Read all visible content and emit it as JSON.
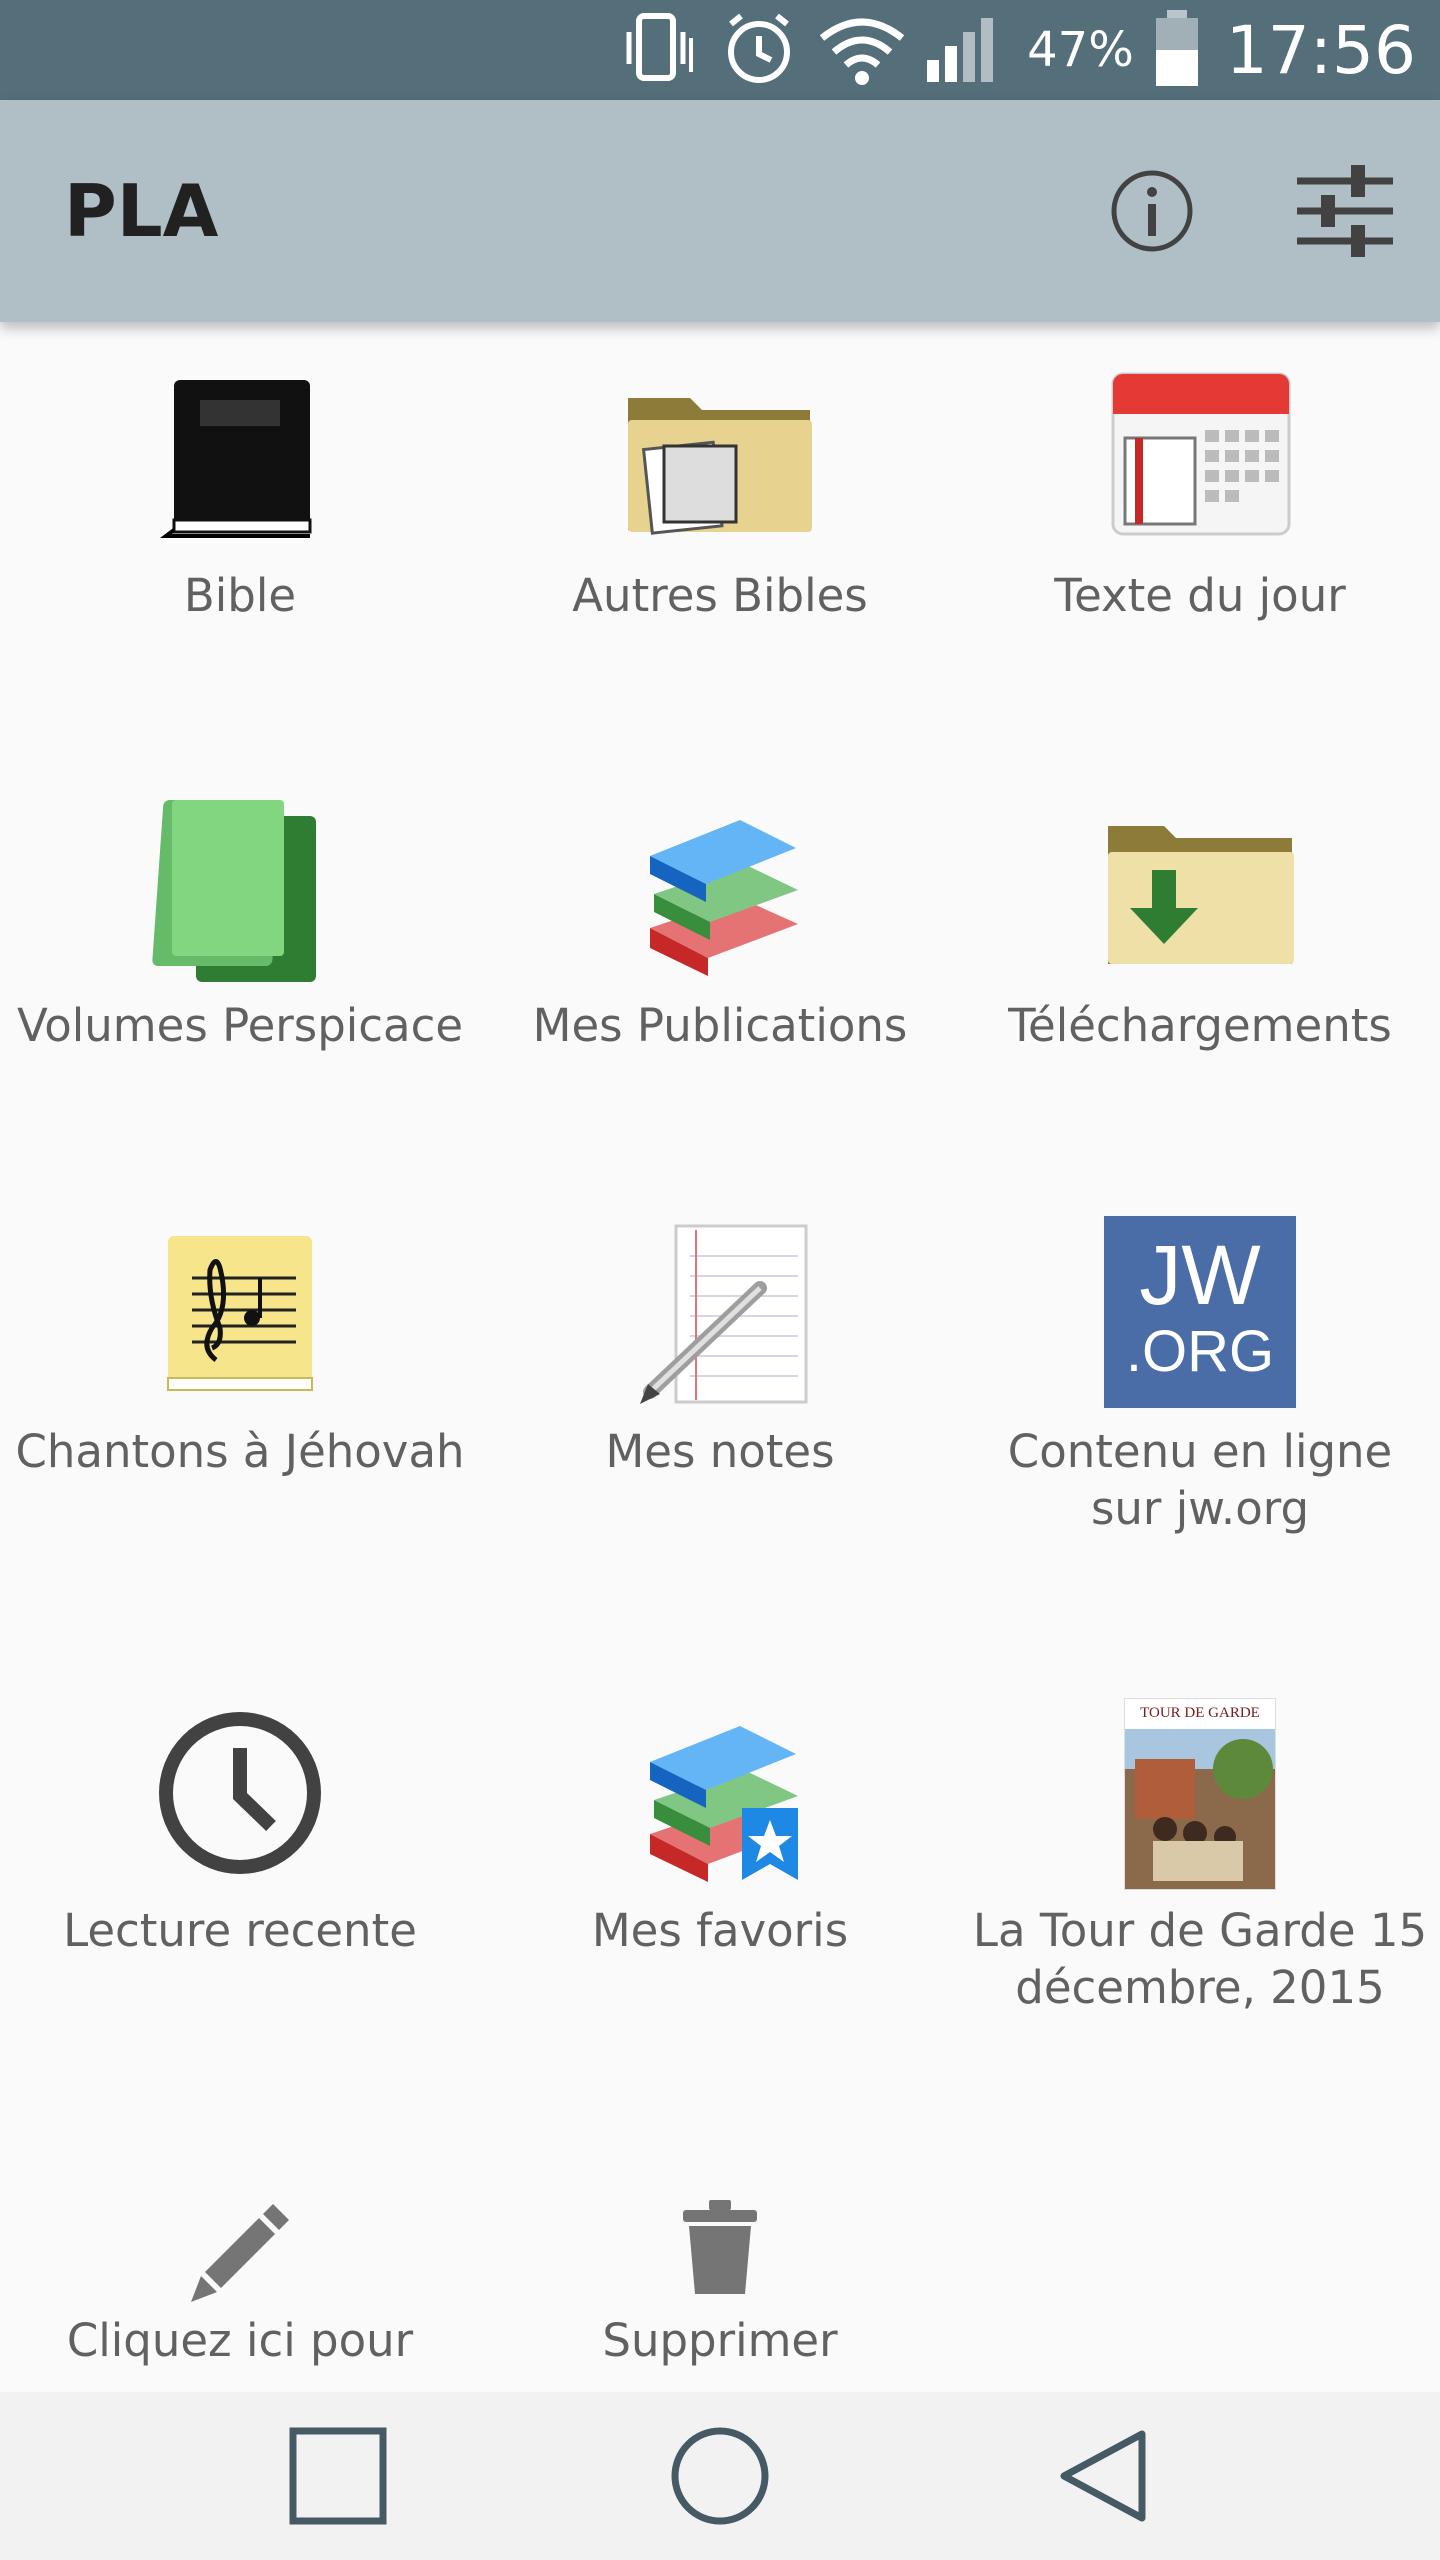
{
  "status_bar": {
    "battery_percent": "47%",
    "time": "17:56"
  },
  "app_bar": {
    "title": "PLA",
    "info_icon": "info-icon",
    "settings_icon": "sliders-icon"
  },
  "grid": {
    "tiles": [
      {
        "label": "Bible",
        "icon": "black-bible-icon"
      },
      {
        "label": "Autres Bibles",
        "icon": "folder-bible-icon"
      },
      {
        "label": "Texte du jour",
        "icon": "calendar-book-icon"
      },
      {
        "label": "Volumes Perspicace",
        "icon": "green-books-icon"
      },
      {
        "label": "Mes Publications",
        "icon": "stacked-books-icon"
      },
      {
        "label": "Téléchargements",
        "icon": "download-folder-icon"
      },
      {
        "label": "Chantons à Jéhovah",
        "icon": "music-note-book-icon"
      },
      {
        "label": "Mes notes",
        "icon": "notepad-pencil-icon"
      },
      {
        "label": "Contenu en ligne sur jw.org",
        "icon": "jw-org-logo-icon",
        "logo_text_1": "JW",
        "logo_text_2": ".ORG"
      },
      {
        "label": "Lecture recente",
        "icon": "clock-icon"
      },
      {
        "label": "Mes favoris",
        "icon": "books-bookmark-star-icon"
      },
      {
        "label": "La Tour de Garde 15 décembre, 2015",
        "icon": "magazine-cover-icon",
        "cover_title": "TOUR DE GARDE"
      },
      {
        "label": "Cliquez ici pour",
        "icon": "pencil-icon"
      },
      {
        "label": "Supprimer",
        "icon": "trash-icon"
      }
    ]
  },
  "nav_bar": {
    "recents": "square-icon",
    "home": "circle-icon",
    "back": "triangle-back-icon"
  },
  "colors": {
    "status_bar": "#546e7a",
    "app_bar": "#b0bec5",
    "background": "#fafafa",
    "label_text": "#616161",
    "jw_blue": "#4a6da7"
  }
}
